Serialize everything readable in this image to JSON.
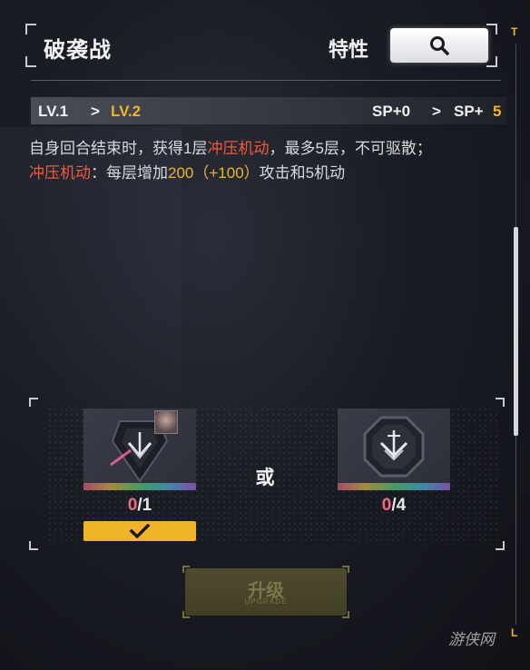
{
  "header": {
    "skill_name": "破袭战",
    "trait_label": "特性"
  },
  "scrollbar": {
    "top_cap": "T",
    "bottom_cap": "L"
  },
  "levels": {
    "from": "LV.1",
    "arrow": ">",
    "to": "LV.2",
    "sp_from": "SP+0",
    "sp_arrow": ">",
    "sp_to_prefix": "SP+",
    "sp_to_value": "5"
  },
  "description": {
    "line1_a": "自身回合结束时，获得1层",
    "line1_keyword": "冲压机动",
    "line1_b": "，最多5层，不可驱散；",
    "line2_keyword": "冲压机动",
    "line2_a": "：每层增加",
    "line2_value": "200（+100）",
    "line2_b": "攻击和5机动"
  },
  "materials": {
    "item1": {
      "have": "0",
      "sep": "/",
      "need": "1",
      "selected": true
    },
    "or_label": "或",
    "item2": {
      "have": "0",
      "sep": "/",
      "need": "4"
    }
  },
  "upgrade_button": {
    "label": "升级",
    "sub_label": "UPGRADE",
    "enabled": false
  },
  "watermark": "游侠网",
  "colors": {
    "accent_gold": "#f0b429",
    "keyword_red": "#f05a3a",
    "count_red": "#f06a7a"
  },
  "icons": {
    "search": "magnifier-icon",
    "selected": "checkmark-icon",
    "item1": "chevron-crest-chip-icon",
    "item2": "octagon-crest-chip-icon"
  }
}
